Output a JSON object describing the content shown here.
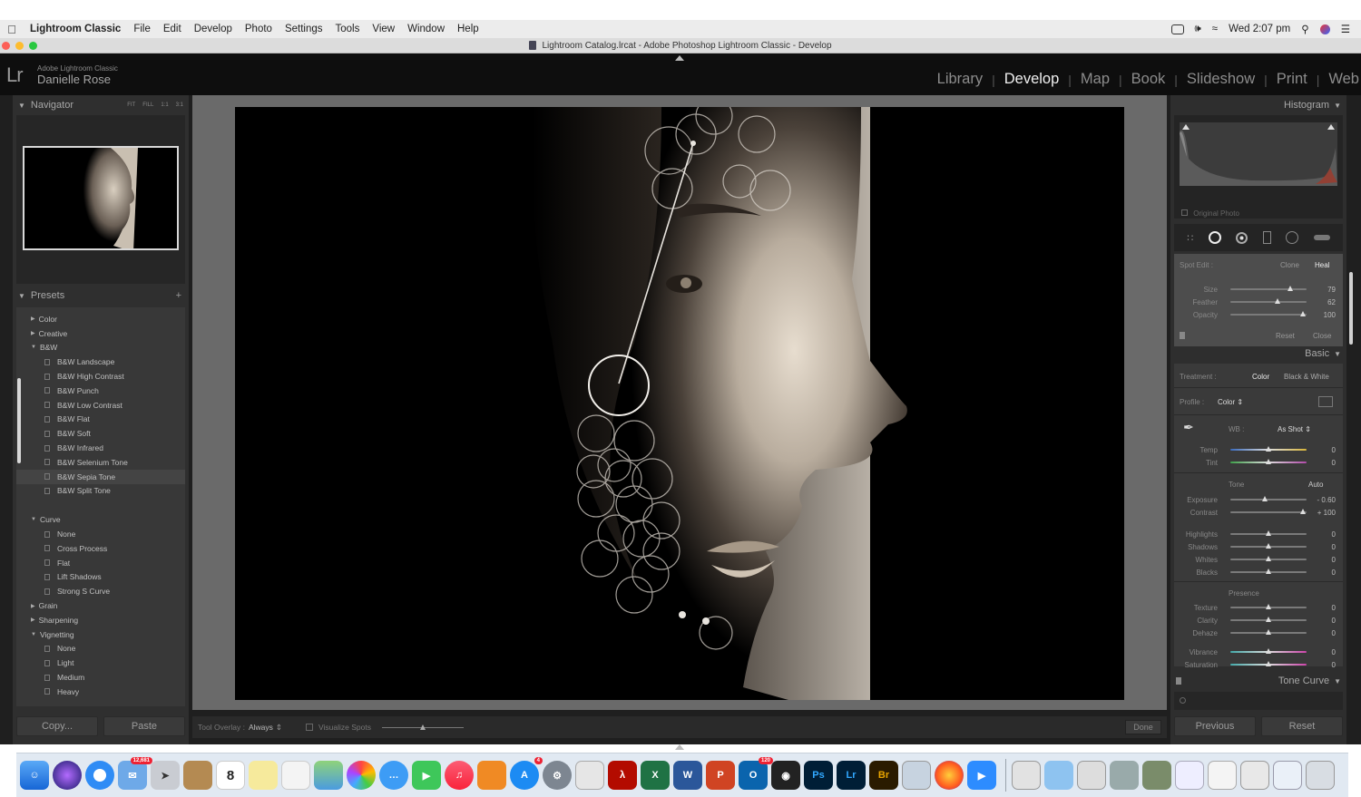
{
  "menubar": {
    "app": "Lightroom Classic",
    "items": [
      "File",
      "Edit",
      "Develop",
      "Photo",
      "Settings",
      "Tools",
      "View",
      "Window",
      "Help"
    ],
    "clock": "Wed 2:07 pm"
  },
  "window": {
    "title": "Lightroom Catalog.lrcat - Adobe Photoshop Lightroom Classic - Develop"
  },
  "identity": {
    "logo": "Lr",
    "product": "Adobe Lightroom Classic",
    "user": "Danielle Rose"
  },
  "modules": {
    "items": [
      "Library",
      "Develop",
      "Map",
      "Book",
      "Slideshow",
      "Print",
      "Web"
    ],
    "active": "Develop"
  },
  "left": {
    "navigator": {
      "title": "Navigator",
      "zoom_options": [
        "FIT",
        "FILL",
        "1:1",
        "3:1"
      ]
    },
    "presets": {
      "title": "Presets",
      "items": [
        {
          "type": "folder",
          "label": "Color"
        },
        {
          "type": "folder",
          "label": "Creative"
        },
        {
          "type": "folder-open",
          "label": "B&W"
        },
        {
          "type": "preset",
          "label": "B&W Landscape"
        },
        {
          "type": "preset",
          "label": "B&W High Contrast"
        },
        {
          "type": "preset",
          "label": "B&W Punch"
        },
        {
          "type": "preset",
          "label": "B&W Low Contrast"
        },
        {
          "type": "preset",
          "label": "B&W Flat"
        },
        {
          "type": "preset",
          "label": "B&W Soft"
        },
        {
          "type": "preset",
          "label": "B&W Infrared"
        },
        {
          "type": "preset",
          "label": "B&W Selenium Tone"
        },
        {
          "type": "preset",
          "label": "B&W Sepia Tone",
          "selected": true
        },
        {
          "type": "preset",
          "label": "B&W Split Tone"
        },
        {
          "type": "gap"
        },
        {
          "type": "folder-open",
          "label": "Curve"
        },
        {
          "type": "preset",
          "label": "None"
        },
        {
          "type": "preset",
          "label": "Cross Process"
        },
        {
          "type": "preset",
          "label": "Flat"
        },
        {
          "type": "preset",
          "label": "Lift Shadows"
        },
        {
          "type": "preset",
          "label": "Strong S Curve"
        },
        {
          "type": "folder",
          "label": "Grain"
        },
        {
          "type": "folder",
          "label": "Sharpening"
        },
        {
          "type": "folder-open",
          "label": "Vignetting"
        },
        {
          "type": "preset",
          "label": "None"
        },
        {
          "type": "preset",
          "label": "Light"
        },
        {
          "type": "preset",
          "label": "Medium"
        },
        {
          "type": "preset",
          "label": "Heavy"
        }
      ]
    },
    "copy_label": "Copy...",
    "paste_label": "Paste"
  },
  "toolbar": {
    "overlay_label": "Tool Overlay :",
    "overlay_value": "Always",
    "visualize_label": "Visualize Spots",
    "done_label": "Done"
  },
  "right": {
    "histogram": {
      "title": "Histogram",
      "original_photo": "Original Photo"
    },
    "spot": {
      "label": "Spot Edit :",
      "clone": "Clone",
      "heal": "Heal",
      "sliders": [
        {
          "label": "Size",
          "value": "79",
          "pos": 0.78
        },
        {
          "label": "Feather",
          "value": "62",
          "pos": 0.62
        },
        {
          "label": "Opacity",
          "value": "100",
          "pos": 0.95
        }
      ],
      "reset": "Reset",
      "close": "Close"
    },
    "basic": {
      "title": "Basic",
      "treatment_label": "Treatment :",
      "treatment_color": "Color",
      "treatment_bw": "Black & White",
      "profile_label": "Profile :",
      "profile_value": "Color",
      "wb_label": "WB :",
      "wb_value": "As Shot",
      "temp": {
        "label": "Temp",
        "value": "0"
      },
      "tint": {
        "label": "Tint",
        "value": "0"
      },
      "tone_label": "Tone",
      "auto_label": "Auto",
      "tone_sliders": [
        {
          "label": "Exposure",
          "value": "- 0.60",
          "pos": 0.45
        },
        {
          "label": "Contrast",
          "value": "+ 100",
          "pos": 0.95
        }
      ],
      "hs_sliders": [
        {
          "label": "Highlights",
          "value": "0",
          "pos": 0.5
        },
        {
          "label": "Shadows",
          "value": "0",
          "pos": 0.5
        },
        {
          "label": "Whites",
          "value": "0",
          "pos": 0.5
        },
        {
          "label": "Blacks",
          "value": "0",
          "pos": 0.5
        }
      ],
      "presence_label": "Presence",
      "presence_sliders": [
        {
          "label": "Texture",
          "value": "0",
          "pos": 0.5
        },
        {
          "label": "Clarity",
          "value": "0",
          "pos": 0.5
        },
        {
          "label": "Dehaze",
          "value": "0",
          "pos": 0.5
        }
      ],
      "color_sliders": [
        {
          "label": "Vibrance",
          "value": "0",
          "pos": 0.5
        },
        {
          "label": "Saturation",
          "value": "0",
          "pos": 0.5
        }
      ]
    },
    "tone_curve": {
      "title": "Tone Curve"
    },
    "previous_label": "Previous",
    "reset_label": "Reset"
  },
  "dock": {
    "calendar_day": "8",
    "badges": {
      "mail": "12,681",
      "appstore": "4",
      "outlook": "120"
    },
    "labels": {
      "photoshop": "Ps",
      "lightroom": "Lr",
      "bridge": "Br"
    }
  }
}
